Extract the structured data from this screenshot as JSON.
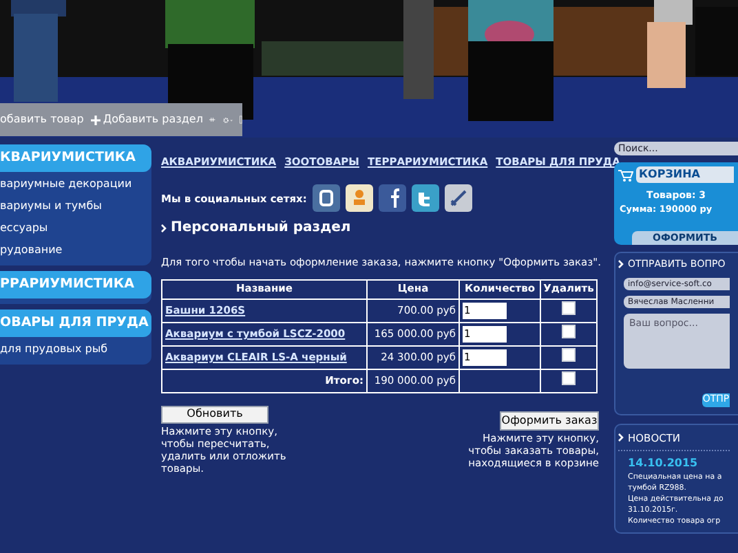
{
  "toolbar": {
    "items": [
      {
        "kind": "text",
        "label": "обавить товар"
      },
      {
        "kind": "plus",
        "label": "Добавить раздел"
      }
    ]
  },
  "sidebar": {
    "sections": [
      {
        "title": "КВАРИУМИСТИКА",
        "items": [
          "вариумные декорации",
          "вариумы и тумбы",
          "ессуары",
          "рудование"
        ]
      },
      {
        "title": "РРАРИУМИСТИКА"
      },
      {
        "title": "ОВАРЫ ДЛЯ ПРУДА",
        "items": [
          "для прудовых рыб"
        ]
      }
    ]
  },
  "nav": {
    "links": [
      "АКВАРИУМИСТИКА",
      "ЗООТОВАРЫ",
      "ТЕРРАРИУМИСТИКА",
      "ТОВАРЫ ДЛЯ ПРУДА"
    ]
  },
  "social": {
    "label": "Мы в социальных сетях:"
  },
  "section_title": "Персональный раздел",
  "instruction": "Для того чтобы начать оформление заказа, нажмите кнопку \"Оформить заказ\".",
  "cart_table": {
    "columns": [
      "Название",
      "Цена",
      "Количество",
      "Удалить"
    ],
    "rows": [
      {
        "name": "Башни 1206S",
        "price": "700.00 руб",
        "quantity": "1",
        "checked": false
      },
      {
        "name": "Аквариум с тумбой LSCZ-2000",
        "price": "165 000.00 руб",
        "quantity": "1",
        "checked": false
      },
      {
        "name": "Аквариум CLEAIR LS-A черный",
        "price": "24 300.00 руб",
        "quantity": "1",
        "checked": false
      }
    ],
    "total": {
      "label": "Итого:",
      "value": "190 000.00 руб",
      "checked": false
    }
  },
  "update_button": {
    "label": "Обновить",
    "hint": [
      "Нажмите эту кнопку,",
      "чтобы пересчитать,",
      "удалить или отложить",
      "товары."
    ]
  },
  "order_button": {
    "label": "Оформить заказ",
    "hint": [
      "Нажмите эту кнопку,",
      "чтобы заказать товары,",
      "находящиеся в корзине"
    ]
  },
  "search": {
    "placeholder": "Поиск..."
  },
  "basket": {
    "title": "КОРЗИНА",
    "count": "Товаров: 3",
    "sum": "Сумма: 190000 ру",
    "button": "ОФОРМИТЬ"
  },
  "question": {
    "title": "ОТПРАВИТЬ ВОПРО",
    "email": "info@service-soft.co",
    "name": "Вячеслав Масленни",
    "placeholder": "Ваш вопрос...",
    "button": "ОТПР"
  },
  "news": {
    "title": "НОВОСТИ",
    "items": [
      {
        "date": "14.10.2015",
        "lines": [
          "Специальная цена на а",
          "тумбой RZ988.",
          "Цена действительна до",
          "31.10.2015г.",
          "Количество товара огр"
        ]
      }
    ]
  }
}
